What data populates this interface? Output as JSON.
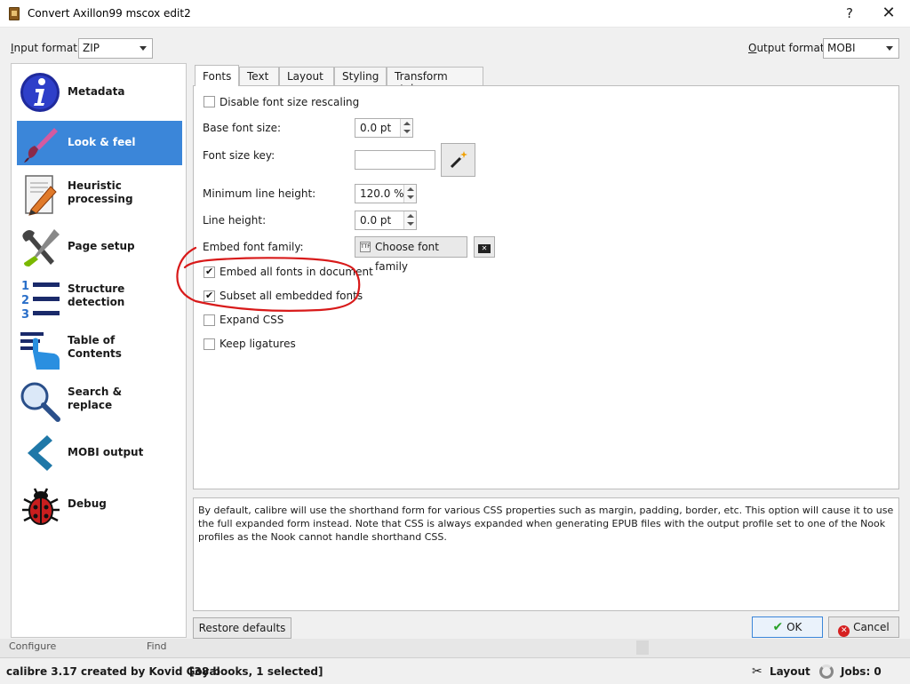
{
  "window": {
    "title": "Convert Axillon99 mscox edit2",
    "help": "?",
    "close": "✕"
  },
  "formats": {
    "input_label": "Input format:",
    "input_value": "ZIP",
    "output_label": "Output format:",
    "output_value": "MOBI"
  },
  "sidebar": {
    "items": [
      {
        "line1": "Metadata",
        "line2": ""
      },
      {
        "line1": "Look & feel",
        "line2": ""
      },
      {
        "line1": "Heuristic",
        "line2": "processing"
      },
      {
        "line1": "Page setup",
        "line2": ""
      },
      {
        "line1": "Structure",
        "line2": "detection"
      },
      {
        "line1": "Table of",
        "line2": "Contents"
      },
      {
        "line1": "Search &",
        "line2": "replace"
      },
      {
        "line1": "MOBI output",
        "line2": ""
      },
      {
        "line1": "Debug",
        "line2": ""
      }
    ]
  },
  "tabs": [
    "Fonts",
    "Text",
    "Layout",
    "Styling",
    "Transform styles"
  ],
  "fonts": {
    "disable_rescaling": "Disable font size rescaling",
    "base_font_size_label": "Base font size:",
    "base_font_size_value": "0.0 pt",
    "font_size_key_label": "Font size key:",
    "font_size_key_value": "",
    "min_line_height_label": "Minimum line height:",
    "min_line_height_value": "120.0 %",
    "line_height_label": "Line height:",
    "line_height_value": "0.0 pt",
    "embed_family_label": "Embed font family:",
    "choose_font_family": "Choose font family",
    "embed_all": "Embed all fonts in document",
    "subset_all": "Subset all embedded fonts",
    "expand_css": "Expand CSS",
    "keep_ligatures": "Keep ligatures",
    "embed_all_checked": true,
    "subset_all_checked": true
  },
  "help_text": "By default, calibre will use the shorthand form for various CSS properties such as margin, padding, border, etc. This option will cause it to use the full expanded form instead. Note that CSS is always expanded when generating EPUB files with the output profile set to one of the Nook profiles as the Nook cannot handle shorthand CSS.",
  "buttons": {
    "restore_defaults": "Restore defaults",
    "ok": "OK",
    "cancel": "Cancel"
  },
  "underbar": {
    "left": "Configure",
    "right": "Find"
  },
  "statusbar": {
    "left": "calibre 3.17 created by Kovid Goyal",
    "books": "[38 books, 1 selected]",
    "layout": "Layout",
    "jobs": "Jobs: 0"
  },
  "colors": {
    "selected": "#3b86d9",
    "annotation": "#d81a1a"
  }
}
